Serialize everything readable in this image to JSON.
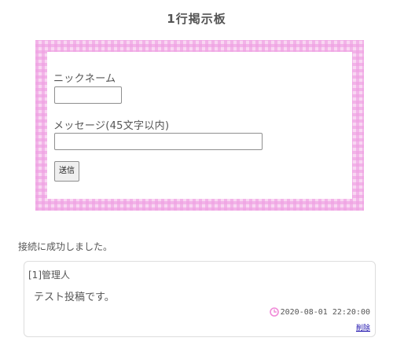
{
  "page": {
    "title": "1行掲示板"
  },
  "form": {
    "nickname_label": "ニックネーム",
    "nickname_value": "",
    "message_label": "メッセージ(45文字以内)",
    "message_value": "",
    "submit_label": "送信"
  },
  "status": {
    "text": "接続に成功しました。"
  },
  "posts": [
    {
      "header": "[1]管理人",
      "body": "テスト投稿です。",
      "timestamp": "2020-08-01 22:20:00",
      "delete_label": "削除"
    }
  ],
  "colors": {
    "frame_pink": "#f9d7f2",
    "check_pink": "#efa0e2",
    "clock_pink": "#f08ad8",
    "link_blue": "#1a0dab"
  },
  "icons": {
    "timestamp": "clock-icon"
  }
}
